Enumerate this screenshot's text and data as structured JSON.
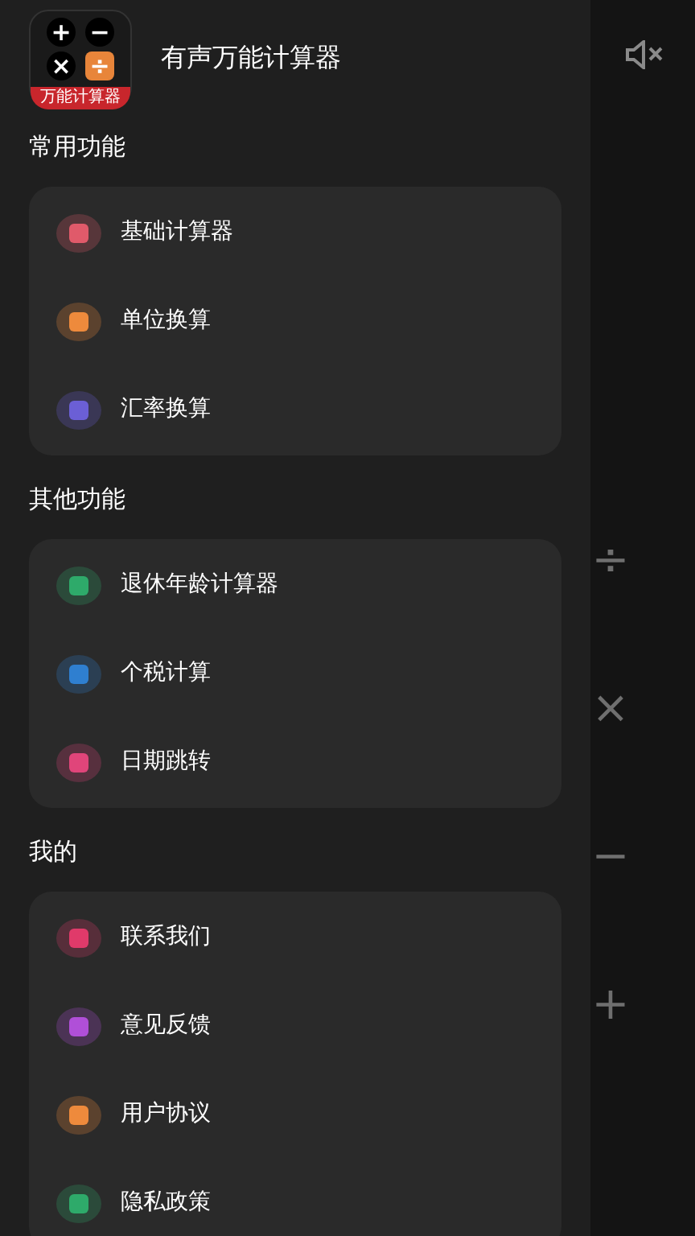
{
  "app": {
    "title": "有声万能计算器",
    "logo_text": "万能计算器",
    "logo_keys": [
      "+",
      "−",
      "×",
      "÷"
    ]
  },
  "sections": [
    {
      "title": "常用功能",
      "items": [
        {
          "label": "基础计算器",
          "color": "#e05a6a"
        },
        {
          "label": "单位换算",
          "color": "#ee8a3c"
        },
        {
          "label": "汇率换算",
          "color": "#6b5fd6"
        }
      ]
    },
    {
      "title": "其他功能",
      "items": [
        {
          "label": "退休年龄计算器",
          "color": "#2eaa6a"
        },
        {
          "label": "个税计算",
          "color": "#2f7fd0"
        },
        {
          "label": "日期跳转",
          "color": "#e0457a"
        }
      ]
    },
    {
      "title": "我的",
      "items": [
        {
          "label": "联系我们",
          "color": "#e03a6a"
        },
        {
          "label": "意见反馈",
          "color": "#b04fd8"
        },
        {
          "label": "用户协议",
          "color": "#ee8a3c"
        },
        {
          "label": "隐私政策",
          "color": "#2eaa6a"
        }
      ]
    }
  ],
  "background": {
    "operator_keys": [
      "÷",
      "×",
      "−",
      "+"
    ]
  }
}
